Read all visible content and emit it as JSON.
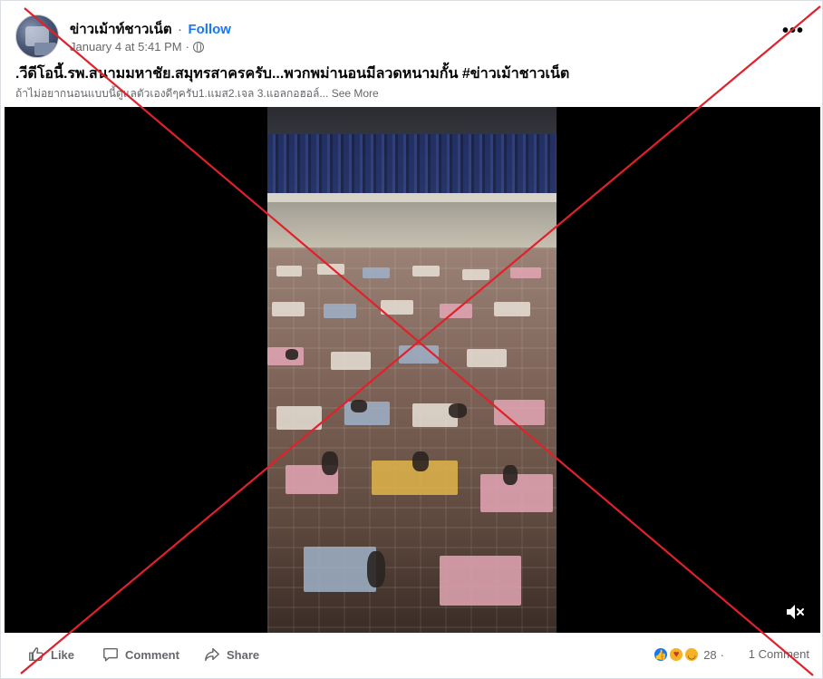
{
  "post": {
    "page_name": "ข่าวเม้าท์ชาวเน็ต",
    "separator": "·",
    "follow_label": "Follow",
    "timestamp": "January 4 at 5:41 PM",
    "meta_separator": "·",
    "title": ".วีดีโอนี้.รพ.สนามมหาชัย.สมุทรสาครครับ...พวกพม่านอนมีลวดหนามกั้น #ข่าวเม้าชาวเน็ต",
    "description": "ถ้าไม่อยากนอนแบบนี้ดูแลตัวเองดีๆครับ1.แมส2.เจล 3.แอลกอฮอล์...",
    "see_more": "See More",
    "more_menu": "•••"
  },
  "actions": {
    "like_label": "Like",
    "comment_label": "Comment",
    "share_label": "Share"
  },
  "engagement": {
    "reaction_count": "28",
    "comment_count": "1 Comment",
    "separator": "·",
    "reaction_icons": [
      "like-icon",
      "haha-care-icon",
      "sad-icon"
    ]
  },
  "overlay": {
    "cross_color": "#e0212b"
  }
}
